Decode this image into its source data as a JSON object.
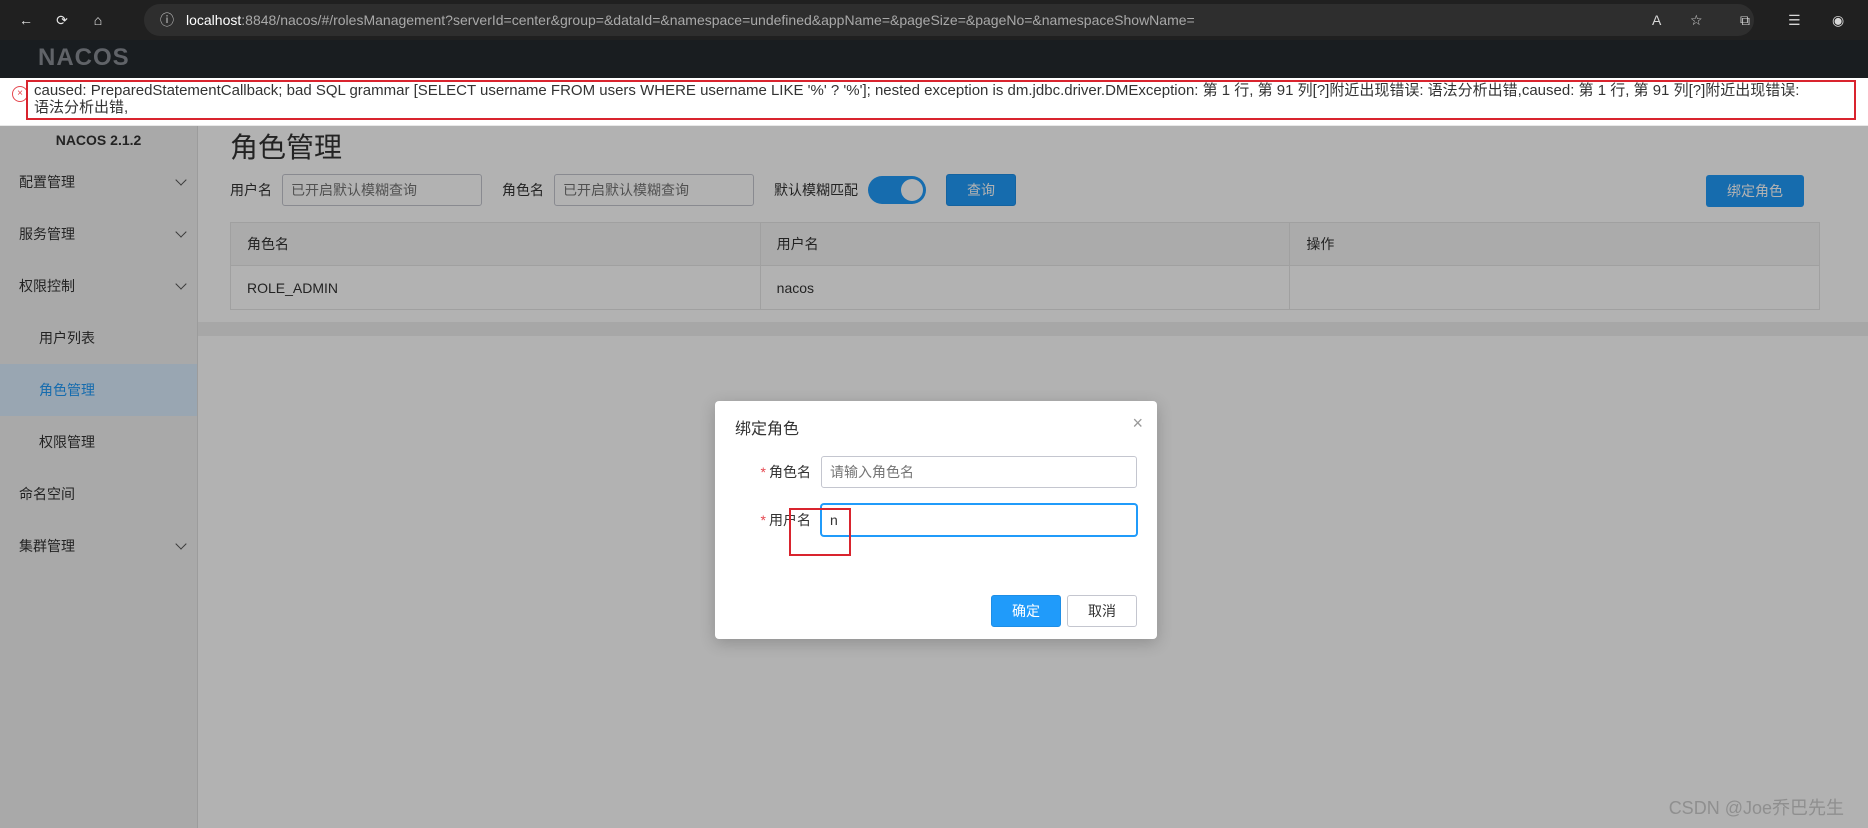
{
  "browser": {
    "url_host": "localhost",
    "url_rest": ":8848/nacos/#/rolesManagement?serverId=center&group=&dataId=&namespace=undefined&appName=&pageSize=&pageNo=&namespaceShowName="
  },
  "app": {
    "logo": "NACOS",
    "version": "NACOS 2.1.2"
  },
  "error": {
    "line1": "caused: PreparedStatementCallback; bad SQL grammar [SELECT username FROM users WHERE username LIKE '%' ? '%']; nested exception is dm.jdbc.driver.DMException: 第 1 行, 第 91 列[?]附近出现错误: 语法分析出错,caused: 第 1 行, 第 91 列[?]附近出现错误:",
    "line2": "语法分析出错,"
  },
  "sidebar": {
    "items": [
      {
        "label": "配置管理",
        "expandable": true
      },
      {
        "label": "服务管理",
        "expandable": true
      },
      {
        "label": "权限控制",
        "expandable": true
      },
      {
        "label": "用户列表",
        "sub": true
      },
      {
        "label": "角色管理",
        "sub": true,
        "active": true
      },
      {
        "label": "权限管理",
        "sub": true
      },
      {
        "label": "命名空间"
      },
      {
        "label": "集群管理",
        "expandable": true
      }
    ]
  },
  "main": {
    "title": "角色管理",
    "search": {
      "username_label": "用户名",
      "username_placeholder": "已开启默认模糊查询",
      "role_label": "角色名",
      "role_placeholder": "已开启默认模糊查询",
      "fuzzy_label": "默认模糊匹配",
      "query_button": "查询"
    },
    "bind_button": "绑定角色",
    "table": {
      "headers": [
        "角色名",
        "用户名",
        "操作"
      ],
      "rows": [
        [
          "ROLE_ADMIN",
          "nacos",
          ""
        ]
      ]
    }
  },
  "modal": {
    "title": "绑定角色",
    "role_label": "角色名",
    "role_placeholder": "请输入角色名",
    "user_label": "用户名",
    "user_value": "n",
    "ok": "确定",
    "cancel": "取消"
  },
  "watermark": "CSDN @Joe乔巴先生",
  "colors": {
    "primary": "#209bfa",
    "error": "#e5464e",
    "annotation": "#d9242e"
  }
}
